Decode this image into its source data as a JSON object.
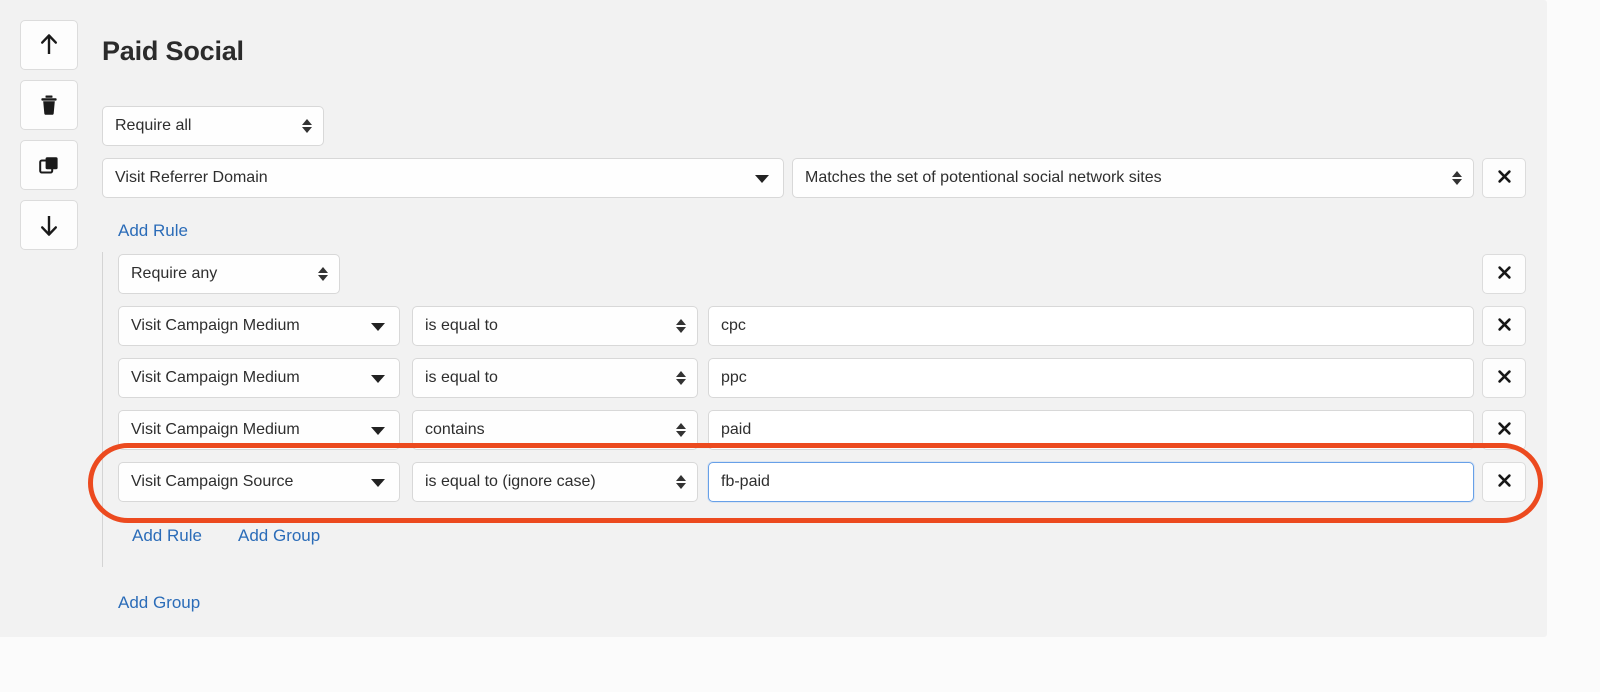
{
  "page": {
    "title": "Paid Social"
  },
  "toolbar": {
    "items": [
      {
        "name": "move-up-button",
        "icon": "arrow-up-icon",
        "label": "Move up"
      },
      {
        "name": "delete-button",
        "icon": "trash-icon",
        "label": "Delete"
      },
      {
        "name": "duplicate-button",
        "icon": "copy-icon",
        "label": "Duplicate"
      },
      {
        "name": "move-down-button",
        "icon": "arrow-down-icon",
        "label": "Move down"
      }
    ]
  },
  "root": {
    "combinator": "Require all",
    "combinator_options": [
      "Require all",
      "Require any"
    ],
    "rule": {
      "field": "Visit Referrer Domain",
      "operator": "Matches the set of potentional social network sites",
      "remove_label": "✕"
    },
    "add_rule_label": "Add Rule",
    "add_group_label": "Add Group"
  },
  "group": {
    "combinator": "Require any",
    "combinator_options": [
      "Require all",
      "Require any"
    ],
    "remove_label": "✕",
    "add_rule_label": "Add Rule",
    "add_group_label": "Add Group",
    "rules": [
      {
        "field": "Visit Campaign Medium",
        "operator": "is equal to",
        "value": "cpc",
        "focused": false,
        "remove_label": "✕"
      },
      {
        "field": "Visit Campaign Medium",
        "operator": "is equal to",
        "value": "ppc",
        "focused": false,
        "remove_label": "✕"
      },
      {
        "field": "Visit Campaign Medium",
        "operator": "contains",
        "value": "paid",
        "focused": false,
        "remove_label": "✕"
      },
      {
        "field": "Visit Campaign Source",
        "operator": "is equal to (ignore case)",
        "value": "fb-paid",
        "focused": true,
        "remove_label": "✕"
      }
    ]
  },
  "annotation": {
    "color": "#ec4a1f",
    "shape": "rounded-rectangle-highlight"
  },
  "colors": {
    "panel_background": "#f2f2f2",
    "page_background": "#fbfbfb",
    "link": "#2b6cb8",
    "focus_border": "#67a0e8",
    "text": "#2e2e2e",
    "annotation": "#ec4a1f"
  }
}
